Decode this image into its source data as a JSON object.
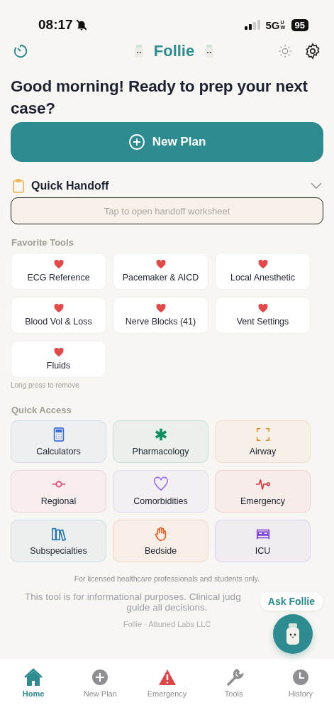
{
  "status_bar": {
    "time": "08:17",
    "network": "5G",
    "network_suffix": "UW",
    "battery": "95"
  },
  "header": {
    "title": "Follie"
  },
  "greeting": "Good morning! Ready to prep your next case?",
  "new_plan_button": {
    "label": "New Plan"
  },
  "quick_handoff": {
    "title": "Quick Handoff",
    "expanded": false,
    "placeholder": "Tap to open handoff worksheet"
  },
  "favorite_tools": {
    "title": "Favorite Tools",
    "hint": "Long press to remove",
    "items": [
      {
        "label": "ECG Reference"
      },
      {
        "label": "Pacemaker & AICD"
      },
      {
        "label": "Local Anesthetic"
      },
      {
        "label": "Blood Vol & Loss"
      },
      {
        "label": "Nerve Blocks (41)"
      },
      {
        "label": "Vent Settings"
      },
      {
        "label": "Fluids"
      }
    ]
  },
  "quick_access": {
    "title": "Quick Access",
    "items": [
      {
        "label": "Calculators",
        "kind": "calculator",
        "color": "#3b6fd8"
      },
      {
        "label": "Pharmacology",
        "kind": "asterisk",
        "color": "#0f8f5f"
      },
      {
        "label": "Airway",
        "kind": "frame",
        "color": "#e0892b"
      },
      {
        "label": "Regional",
        "kind": "node",
        "color": "#e0457b"
      },
      {
        "label": "Comorbidities",
        "kind": "heart",
        "color": "#9b6ee8"
      },
      {
        "label": "Emergency",
        "kind": "pulse",
        "color": "#d8343a"
      },
      {
        "label": "Subspecialties",
        "kind": "books",
        "color": "#2a77b0"
      },
      {
        "label": "Bedside",
        "kind": "hand",
        "color": "#ea5a1a"
      },
      {
        "label": "ICU",
        "kind": "bed",
        "color": "#7b3fd6"
      }
    ]
  },
  "footer": {
    "notice": "For licensed healthcare professionals and students only.",
    "disclaimer_lines": [
      "This tool is for informational purposes. Clinical judg",
      "guide all decisions."
    ],
    "company": "Follie · Attuned Labs LLC"
  },
  "ask_button": {
    "label": "Ask Follie"
  },
  "bottom_nav": [
    {
      "label": "Home",
      "kind": "home",
      "selected": true
    },
    {
      "label": "New Plan",
      "kind": "plus",
      "selected": false
    },
    {
      "label": "Emergency",
      "kind": "alert",
      "selected": false
    },
    {
      "label": "Tools",
      "kind": "wrench",
      "selected": false
    },
    {
      "label": "History",
      "kind": "clock",
      "selected": false
    }
  ]
}
